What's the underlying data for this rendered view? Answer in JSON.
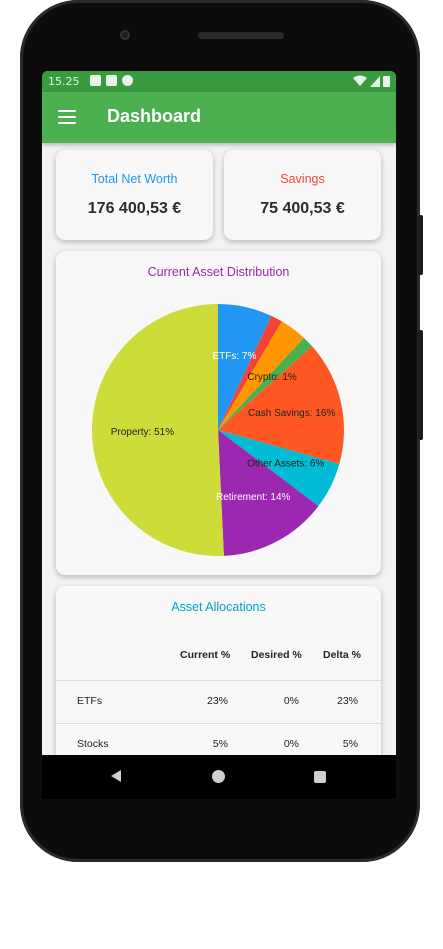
{
  "status_bar": {
    "time": "15.25"
  },
  "app_bar": {
    "title": "Dashboard"
  },
  "summary": {
    "net_worth": {
      "label": "Total Net Worth",
      "value": "176 400,53 €",
      "color": "#2196f3"
    },
    "savings": {
      "label": "Savings",
      "value": "75 400,53 €",
      "color": "#f44336"
    }
  },
  "chart_data": {
    "type": "pie",
    "title": "Current Asset Distribution",
    "slices": [
      {
        "label": "ETFs: 7%",
        "value": 7,
        "color": "#2196f3"
      },
      {
        "label": "",
        "value": 1.5,
        "color": "#f44336"
      },
      {
        "label": "",
        "value": 3.5,
        "color": "#ff9800"
      },
      {
        "label": "Crypto: 1%",
        "value": 1.5,
        "color": "#4caf50"
      },
      {
        "label": "Cash Savings: 16%",
        "value": 16,
        "color": "#ff5722"
      },
      {
        "label": "Other Assets: 6%",
        "value": 6,
        "color": "#00bcd4"
      },
      {
        "label": "Retirement: 14%",
        "value": 14,
        "color": "#9c27b0"
      },
      {
        "label": "Property: 51%",
        "value": 51,
        "color": "#cddc39"
      }
    ]
  },
  "allocations": {
    "title": "Asset Allocations",
    "headers": [
      "Current %",
      "Desired %",
      "Delta %"
    ],
    "rows": [
      {
        "name": "ETFs",
        "current": "23%",
        "desired": "0%",
        "delta": "23%"
      },
      {
        "name": "Stocks",
        "current": "5%",
        "desired": "0%",
        "delta": "5%"
      }
    ]
  }
}
